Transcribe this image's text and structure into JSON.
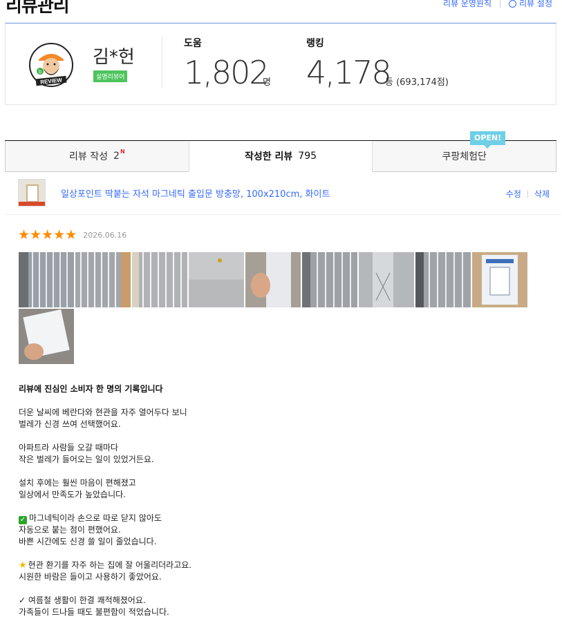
{
  "header": {
    "title": "리뷰관리",
    "links": [
      "리뷰 운영원칙",
      "리뷰 설정"
    ]
  },
  "profile": {
    "avatar_text": "REVIEW",
    "name": "김*헌",
    "badge": "실명리뷰어",
    "help_label": "도움",
    "help_value": "1,802",
    "help_unit": "명",
    "rank_label": "랭킹",
    "rank_value": "4,178",
    "rank_unit": "등 (693,174점)"
  },
  "tabs": [
    {
      "label": "리뷰 작성",
      "count": "2",
      "new": "N",
      "active": false
    },
    {
      "label": "작성한 리뷰",
      "count": "795",
      "active": true
    },
    {
      "label": "쿠팡체험단",
      "count": "",
      "active": false
    }
  ],
  "open_tag": "OPEN!",
  "product": {
    "name": "일상포인트 딱붙는 자석 마그네틱 출입문 방충망, 100x210cm, 화이트",
    "edit_label": "수정",
    "delete_label": "삭제"
  },
  "review": {
    "rating": 5,
    "date": "2026.06.16",
    "photo_count": 10,
    "title": "리뷰에 진심인 소비자 한 명의 기록입니다",
    "paragraphs": [
      [
        "더운 날씨에 베란다와 현관을 자주 열어두다 보니",
        "벌레가 신경 쓰여 선택했어요."
      ],
      [
        "아파트라 사람들 오갈 때마다",
        "작은 벌레가 들어오는 일이 있었거든요."
      ],
      [
        "설치 후에는 훨씬 마음이 편해졌고",
        "일상에서 만족도가 높았습니다."
      ],
      [
        "마그네틱이라 손으로 따로 닫지 않아도",
        "자동으로 붙는 점이 편했어요.",
        "바쁜 시간에도 신경 쓸 일이 줄었습니다."
      ],
      [
        "현관 환기를 자주 하는 집에 잘 어울리더라고요.",
        "시원한 바람은 들이고 사용하기 좋았어요."
      ],
      [
        "여름철 생활이 한결 쾌적해졌어요.",
        "가족들이 드나들 때도 불편함이 적었습니다."
      ]
    ],
    "paragraph_icons": [
      "",
      "",
      "",
      "check-box-icon",
      "star-icon",
      "checkmark-icon"
    ]
  },
  "colors": {
    "accent": "#346aff",
    "star": "#ff8a00",
    "badge": "#4dc45c",
    "open_tag": "#6ecfe6"
  }
}
